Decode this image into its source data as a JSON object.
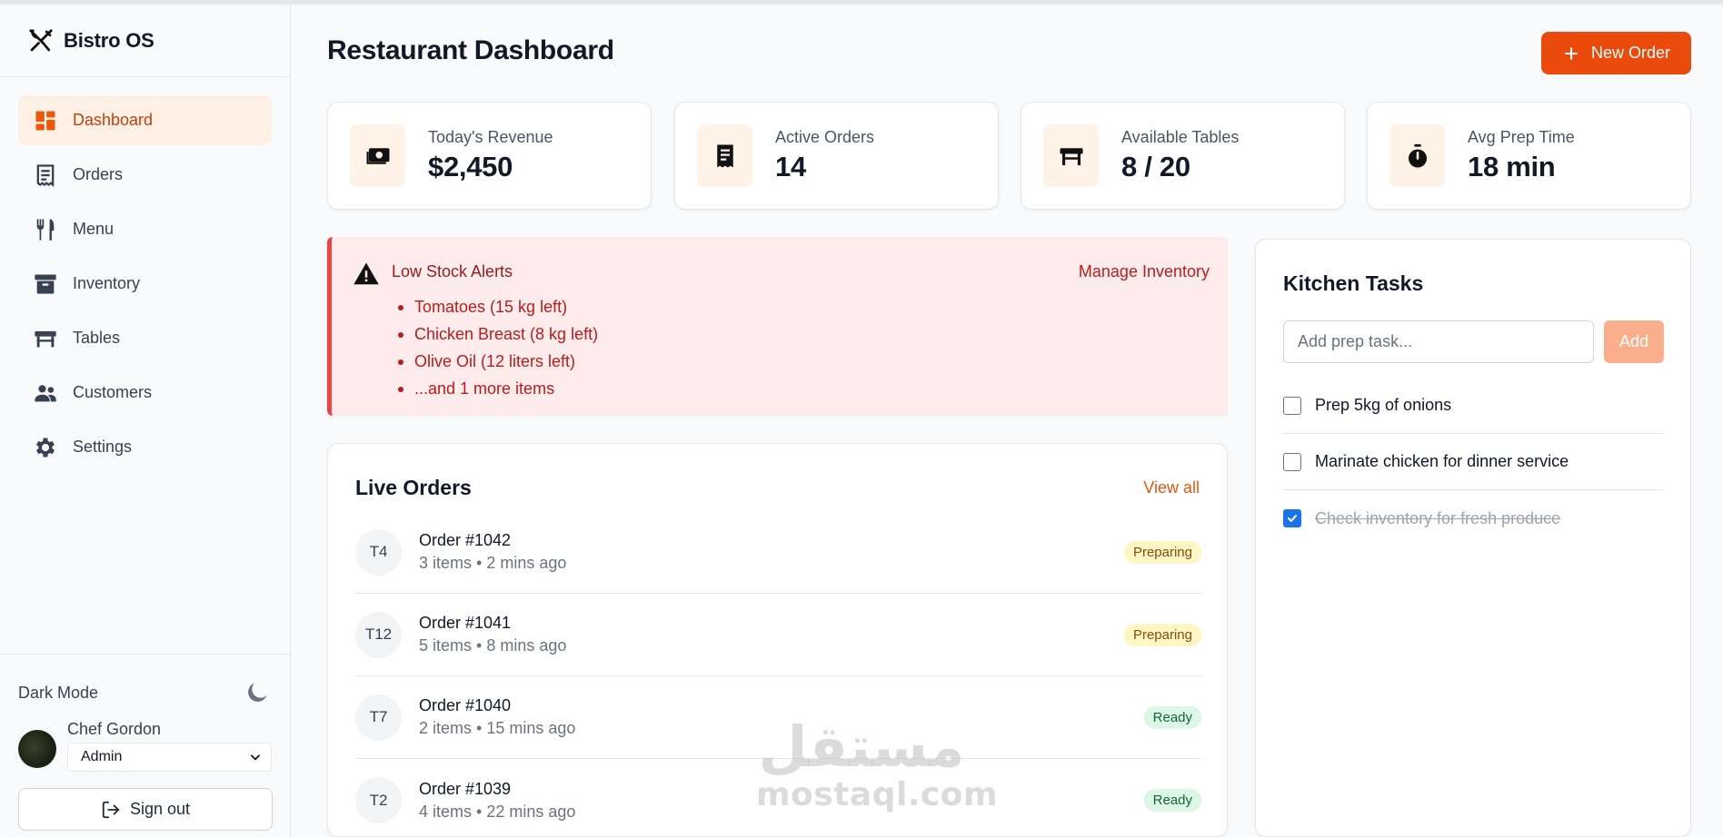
{
  "app": {
    "name": "Bistro OS"
  },
  "sidebar": {
    "items": [
      {
        "label": "Dashboard",
        "icon": "dashboard-icon",
        "active": true
      },
      {
        "label": "Orders",
        "icon": "receipt-icon"
      },
      {
        "label": "Menu",
        "icon": "utensils-icon"
      },
      {
        "label": "Inventory",
        "icon": "archive-icon"
      },
      {
        "label": "Tables",
        "icon": "table-icon"
      },
      {
        "label": "Customers",
        "icon": "people-icon"
      },
      {
        "label": "Settings",
        "icon": "gear-icon"
      }
    ],
    "dark_mode_label": "Dark Mode",
    "user": {
      "name": "Chef Gordon",
      "role": "Admin"
    },
    "signout_label": "Sign out"
  },
  "header": {
    "title": "Restaurant Dashboard",
    "new_order_label": "New Order"
  },
  "stats": [
    {
      "label": "Today's Revenue",
      "value": "$2,450",
      "icon": "cash-icon"
    },
    {
      "label": "Active Orders",
      "value": "14",
      "icon": "receipt-icon"
    },
    {
      "label": "Available Tables",
      "value": "8 / 20",
      "icon": "table-icon"
    },
    {
      "label": "Avg Prep Time",
      "value": "18 min",
      "icon": "timer-icon"
    }
  ],
  "alerts": {
    "title": "Low Stock Alerts",
    "link_label": "Manage Inventory",
    "items": [
      "Tomatoes (15 kg left)",
      "Chicken Breast (8 kg left)",
      "Olive Oil (12 liters left)",
      "...and 1 more items"
    ]
  },
  "orders": {
    "title": "Live Orders",
    "view_all_label": "View all",
    "rows": [
      {
        "table": "T4",
        "id": "Order #1042",
        "meta": "3 items • 2 mins ago",
        "status": "Preparing"
      },
      {
        "table": "T12",
        "id": "Order #1041",
        "meta": "5 items • 8 mins ago",
        "status": "Preparing"
      },
      {
        "table": "T7",
        "id": "Order #1040",
        "meta": "2 items • 15 mins ago",
        "status": "Ready"
      },
      {
        "table": "T2",
        "id": "Order #1039",
        "meta": "4 items • 22 mins ago",
        "status": "Ready"
      }
    ]
  },
  "tasks": {
    "title": "Kitchen Tasks",
    "input_placeholder": "Add prep task...",
    "add_label": "Add",
    "items": [
      {
        "text": "Prep 5kg of onions",
        "done": false
      },
      {
        "text": "Marinate chicken for dinner service",
        "done": false
      },
      {
        "text": "Check inventory for fresh produce",
        "done": true
      }
    ]
  },
  "watermark": {
    "arabic": "مستقل",
    "latin": "mostaql.com"
  },
  "colors": {
    "accent": "#ea4a0c",
    "accent_soft": "#fff3e8",
    "alert_bg": "#fdeceb",
    "alert_text": "#b91c1c",
    "preparing_bg": "#fef6c3",
    "ready_bg": "#ddf7e6"
  }
}
